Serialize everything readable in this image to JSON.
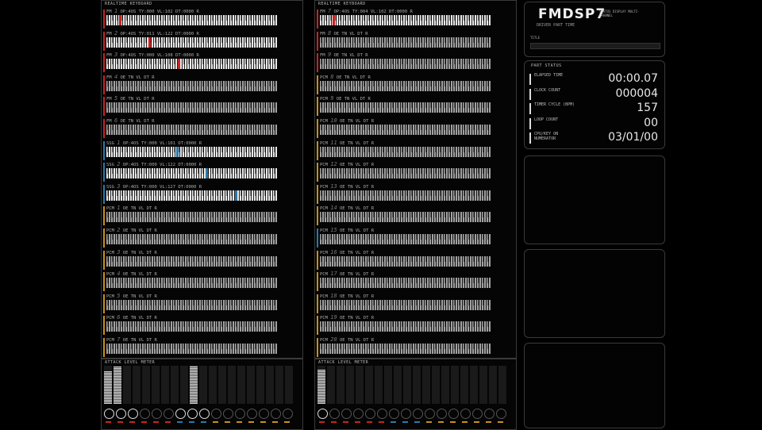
{
  "left_keyboard": {
    "title": "REALTIME KEYBOARD",
    "channels": [
      {
        "type": "FM",
        "num": "1",
        "info": "OP:4OS  TY:000 VL:102 DT:0000 R",
        "color": "#c22",
        "lit": true
      },
      {
        "type": "FM",
        "num": "2",
        "info": "OP:4OS  TY:011 VL:122 DT:0000 R",
        "color": "#c22",
        "lit": true
      },
      {
        "type": "FM",
        "num": "3",
        "info": "OP:4OS  TY:000 VL:108 DT:0000 R",
        "color": "#c22",
        "lit": true
      },
      {
        "type": "FM",
        "num": "4",
        "info": "OE     TN     VL     DT     R",
        "color": "#c22",
        "lit": false
      },
      {
        "type": "FM",
        "num": "5",
        "info": "OE     TN     VL     DT     R",
        "color": "#c22",
        "lit": false
      },
      {
        "type": "FM",
        "num": "6",
        "info": "OE     TN     VL     DT     R",
        "color": "#c22",
        "lit": false
      },
      {
        "type": "SSG",
        "num": "1",
        "info": "OP:4OS  TY:000 VL:101 DT:0000 R",
        "color": "#2a7aa8",
        "lit": true
      },
      {
        "type": "SSG",
        "num": "2",
        "info": "OP:4OS  TY:000 VL:122 DT:0000 R",
        "color": "#2a7aa8",
        "lit": true
      },
      {
        "type": "SSG",
        "num": "3",
        "info": "OP:4OS  TY:000 VL:127 DT:0000 R",
        "color": "#2a7aa8",
        "lit": true
      },
      {
        "type": "PCM",
        "num": "1",
        "info": "OE     TN     VL     DT     R",
        "color": "#c8901a",
        "lit": false
      },
      {
        "type": "PCM",
        "num": "2",
        "info": "OE     TN     VL     DT     R",
        "color": "#c8901a",
        "lit": false
      },
      {
        "type": "PCM",
        "num": "3",
        "info": "OE     TN     VL     DT     R",
        "color": "#c8901a",
        "lit": false
      },
      {
        "type": "PCM",
        "num": "4",
        "info": "OE     TN     VL     DT     R",
        "color": "#c8901a",
        "lit": false
      },
      {
        "type": "PCM",
        "num": "5",
        "info": "OE     TN     VL     DT     R",
        "color": "#c8901a",
        "lit": false
      },
      {
        "type": "PCM",
        "num": "6",
        "info": "OE     TN     VL     DT     R",
        "color": "#c8901a",
        "lit": false
      },
      {
        "type": "PCM",
        "num": "7",
        "info": "OE     TN     VL     DT     R",
        "color": "#c8901a",
        "lit": false
      }
    ]
  },
  "right_keyboard": {
    "title": "REALTIME KEYBOARD",
    "channels": [
      {
        "type": "FM",
        "num": "7",
        "info": "OP:4OS  TY:004 VL:102 DT:0000 R",
        "color": "#c22",
        "lit": true
      },
      {
        "type": "FM",
        "num": "8",
        "info": "OE     TN     VL     DT     R",
        "color": "#c22",
        "lit": false
      },
      {
        "type": "FM",
        "num": "9",
        "info": "OE     TN     VL     DT     R",
        "color": "#c22",
        "lit": false
      },
      {
        "type": "PCM",
        "num": "8",
        "info": "OE     TN     VL     DT     R",
        "color": "#c8901a",
        "lit": false
      },
      {
        "type": "PCM",
        "num": "9",
        "info": "OE     TN     VL     DT     R",
        "color": "#c8901a",
        "lit": false
      },
      {
        "type": "PCM",
        "num": "10",
        "info": "OE     TN     VL     DT     R",
        "color": "#c8901a",
        "lit": false
      },
      {
        "type": "PCM",
        "num": "11",
        "info": "OE     TN     VL     DT     R",
        "color": "#c8901a",
        "lit": false
      },
      {
        "type": "PCM",
        "num": "12",
        "info": "OE     TN     VL     DT     R",
        "color": "#c8901a",
        "lit": false
      },
      {
        "type": "PCM",
        "num": "13",
        "info": "OE     TN     VL     DT     R",
        "color": "#c8901a",
        "lit": false
      },
      {
        "type": "PCM",
        "num": "14",
        "info": "OE     TN     VL     DT     R",
        "color": "#c8901a",
        "lit": false
      },
      {
        "type": "PCM",
        "num": "15",
        "info": "OE     TN     VL     DT     R",
        "color": "#2a7aa8",
        "lit": false
      },
      {
        "type": "PCM",
        "num": "16",
        "info": "OE     TN     VL     DT     R",
        "color": "#c8901a",
        "lit": false
      },
      {
        "type": "PCM",
        "num": "17",
        "info": "OE     TN     VL     DT     R",
        "color": "#c8901a",
        "lit": false
      },
      {
        "type": "PCM",
        "num": "18",
        "info": "OE     TN     VL     DT     R",
        "color": "#c8901a",
        "lit": false
      },
      {
        "type": "PCM",
        "num": "19",
        "info": "OE     TN     VL     DT     R",
        "color": "#c8901a",
        "lit": false
      },
      {
        "type": "PCM",
        "num": "20",
        "info": "OE     TN     VL     DT     R",
        "color": "#c8901a",
        "lit": false
      }
    ]
  },
  "left_meter": {
    "title": "ATTACK LEVEL METER",
    "levels": [
      0.85,
      0.98,
      0,
      0,
      0,
      0,
      0,
      0,
      0,
      1.0,
      0,
      0,
      0,
      0,
      0,
      0,
      0,
      0,
      0,
      0
    ],
    "circles_on": [
      true,
      true,
      true,
      false,
      false,
      false,
      true,
      true,
      true,
      false,
      false,
      false,
      false,
      false,
      false,
      false
    ]
  },
  "right_meter": {
    "title": "ATTACK LEVEL METER",
    "levels": [
      0.9,
      0,
      0,
      0,
      0,
      0,
      0,
      0,
      0,
      0,
      0,
      0,
      0,
      0,
      0,
      0,
      0,
      0,
      0,
      0
    ],
    "circles_on": [
      true,
      false,
      false,
      false,
      false,
      false,
      false,
      false,
      false,
      false,
      false,
      false,
      false,
      false,
      false,
      false
    ]
  },
  "header": {
    "logo": "FMDSP7",
    "logo_sub": "STATUS DISPLAY  MULTI-CHANNEL",
    "driver": "DRIVER PART TIME",
    "title_label": "TITLE"
  },
  "part_status": {
    "title": "PART STATUS",
    "rows": [
      {
        "label": "ELAPSED TIME",
        "value": "00:00.07"
      },
      {
        "label": "CLOCK COUNT",
        "value": "000004"
      },
      {
        "label": "TIMER CYCLE (BPM)",
        "value": "157"
      },
      {
        "label": "LOOP COUNT",
        "value": "00"
      },
      {
        "label": "CPU/KEY ON NUMERATOR",
        "value": "03/01/00"
      }
    ]
  }
}
